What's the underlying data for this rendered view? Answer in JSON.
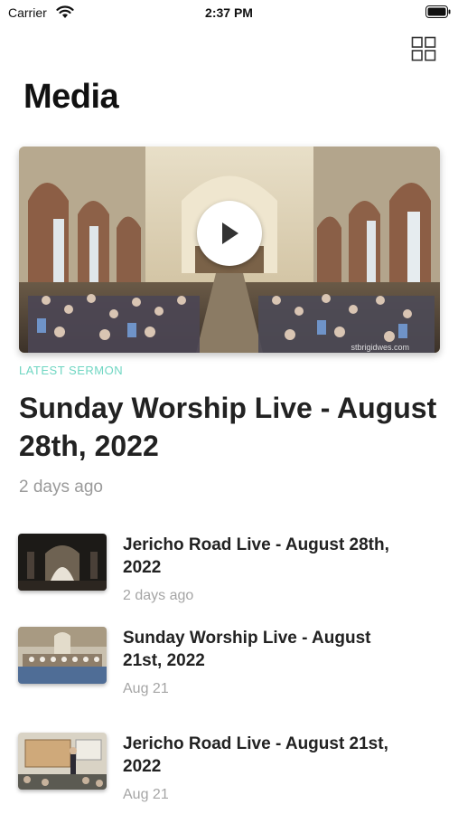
{
  "status_bar": {
    "carrier": "Carrier",
    "time": "2:37 PM"
  },
  "header": {
    "title": "Media",
    "grid_icon": "grid-icon"
  },
  "featured": {
    "label": "LATEST SERMON",
    "title": "Sunday Worship Live - August 28th, 2022",
    "date": "2 days ago",
    "watermark": "stbrigidwes.com"
  },
  "media_list": [
    {
      "title": "Jericho Road Live - August 28th, 2022",
      "date": "2 days ago"
    },
    {
      "title": "Sunday Worship Live - August 21st, 2022",
      "date": "Aug 21"
    },
    {
      "title": "Jericho Road Live - August 21st, 2022",
      "date": "Aug 21"
    }
  ],
  "colors": {
    "accent": "#6fd6c2",
    "secondary_text": "#9a9a9a"
  }
}
